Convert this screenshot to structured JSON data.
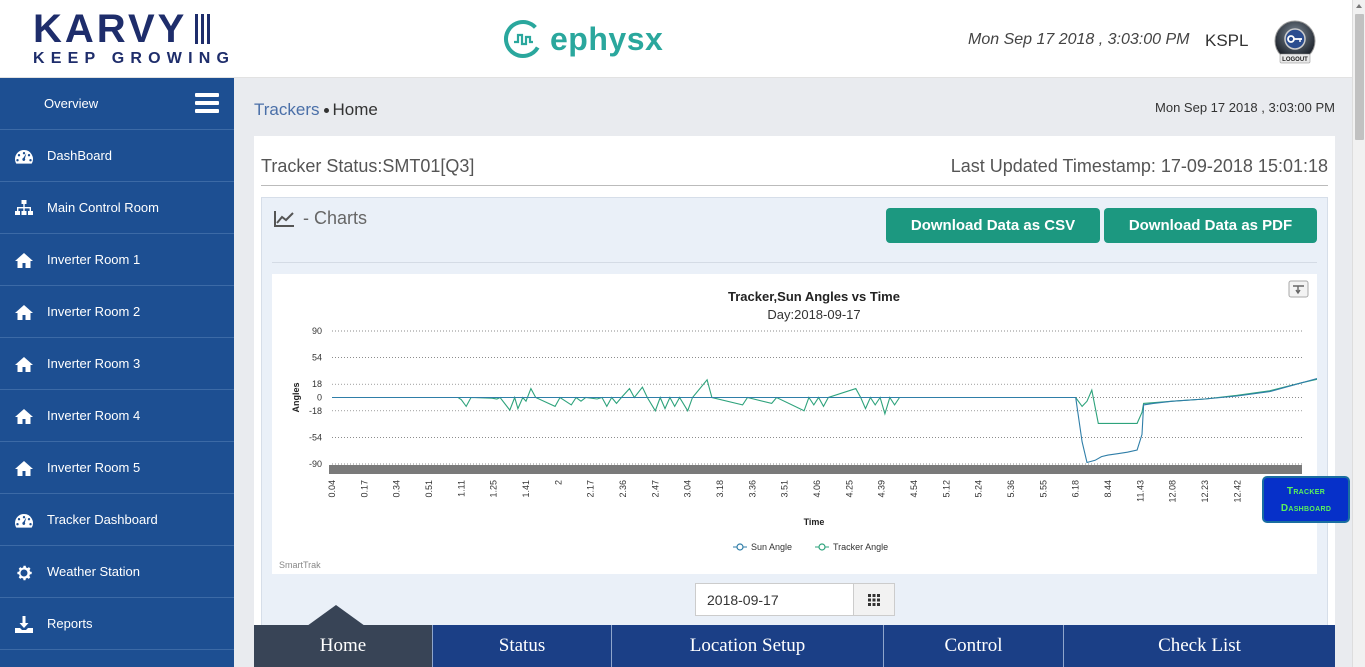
{
  "header": {
    "brand_name": "KARVY",
    "brand_tagline": "KEEP GROWING",
    "ephysx_name": "ephysx",
    "datetime": "Mon Sep 17 2018 , 3:03:00 PM",
    "user": "KSPL",
    "logout_label": "LOGOUT"
  },
  "sidebar": {
    "top_label": "Overview",
    "items": [
      {
        "label": "DashBoard",
        "icon": "dashboard-gauge-icon"
      },
      {
        "label": "Main Control Room",
        "icon": "sitemap-icon"
      },
      {
        "label": "Inverter Room 1",
        "icon": "home-icon"
      },
      {
        "label": "Inverter Room 2",
        "icon": "home-icon"
      },
      {
        "label": "Inverter Room 3",
        "icon": "home-icon"
      },
      {
        "label": "Inverter Room 4",
        "icon": "home-icon"
      },
      {
        "label": "Inverter Room 5",
        "icon": "home-icon"
      },
      {
        "label": "Tracker Dashboard",
        "icon": "dashboard-gauge-icon"
      },
      {
        "label": "Weather Station",
        "icon": "gear-icon"
      },
      {
        "label": "Reports",
        "icon": "download-icon"
      }
    ]
  },
  "breadcrumb": {
    "link": "Trackers",
    "current": "Home"
  },
  "content_time": "Mon Sep 17 2018 , 3:03:00 PM",
  "status": {
    "title": "Tracker Status:SMT01[Q3]",
    "last_updated": "Last Updated Timestamp: 17-09-2018 15:01:18"
  },
  "charts": {
    "heading": "- Charts",
    "csv_label": "Download Data as CSV",
    "pdf_label": "Download Data as PDF",
    "credit": "SmartTrak"
  },
  "chart_data": {
    "type": "line",
    "title": "Tracker,Sun Angles vs Time",
    "subtitle": "Day:2018-09-17",
    "xlabel": "Time",
    "ylabel": "Angles",
    "ylim": [
      -90,
      90
    ],
    "y_ticks": [
      90,
      54,
      18,
      0,
      -18,
      -54,
      -90
    ],
    "x_ticks": [
      "0.04",
      "0.17",
      "0.34",
      "0.51",
      "1.11",
      "1.25",
      "1.41",
      "2",
      "2.17",
      "2.36",
      "2.47",
      "3.04",
      "3.18",
      "3.36",
      "3.51",
      "4.06",
      "4.25",
      "4.39",
      "4.54",
      "5.12",
      "5.24",
      "5.36",
      "5.55",
      "6.18",
      "8.44",
      "11.43",
      "12.08",
      "12.23",
      "12.42",
      "13.14",
      "14.03"
    ],
    "legend": "bottom-center",
    "grid": true,
    "series": [
      {
        "name": "Sun Angle",
        "color": "#2f7ea8",
        "points": [
          [
            0,
            0
          ],
          [
            23,
            0
          ],
          [
            23.2,
            -60
          ],
          [
            23.35,
            -88
          ],
          [
            23.6,
            -85
          ],
          [
            23.8,
            -80
          ],
          [
            24.0,
            -78
          ],
          [
            24.3,
            -76
          ],
          [
            24.6,
            -74
          ],
          [
            24.9,
            -71
          ],
          [
            25.05,
            -50
          ],
          [
            25.1,
            -10
          ],
          [
            25.4,
            -8
          ],
          [
            26,
            -5
          ],
          [
            27,
            -2
          ],
          [
            28,
            2
          ],
          [
            29,
            8
          ],
          [
            30,
            20
          ],
          [
            31,
            32
          ],
          [
            31.4,
            40
          ],
          [
            32.0,
            45
          ]
        ]
      },
      {
        "name": "Tracker Angle",
        "color": "#2ea37c",
        "points": [
          [
            0,
            0
          ],
          [
            3.9,
            0
          ],
          [
            4.0,
            -3
          ],
          [
            4.15,
            -12
          ],
          [
            4.3,
            0
          ],
          [
            4.95,
            -1
          ],
          [
            5.1,
            -2
          ],
          [
            5.2,
            0
          ],
          [
            5.5,
            -17
          ],
          [
            5.65,
            0
          ],
          [
            5.75,
            -15
          ],
          [
            5.9,
            0
          ],
          [
            6.0,
            -5
          ],
          [
            6.15,
            12
          ],
          [
            6.3,
            0
          ],
          [
            6.9,
            -12
          ],
          [
            7.05,
            0
          ],
          [
            7.4,
            -10
          ],
          [
            7.55,
            0
          ],
          [
            7.7,
            -5
          ],
          [
            7.85,
            0
          ],
          [
            8.2,
            -2
          ],
          [
            8.35,
            0
          ],
          [
            8.5,
            -12
          ],
          [
            8.65,
            0
          ],
          [
            8.8,
            -8
          ],
          [
            8.95,
            0
          ],
          [
            9.2,
            12
          ],
          [
            9.35,
            0
          ],
          [
            9.6,
            14
          ],
          [
            9.75,
            0
          ],
          [
            10.0,
            -18
          ],
          [
            10.15,
            0
          ],
          [
            10.3,
            -15
          ],
          [
            10.45,
            0
          ],
          [
            10.6,
            -12
          ],
          [
            10.75,
            0
          ],
          [
            11.0,
            -18
          ],
          [
            11.15,
            0
          ],
          [
            11.6,
            24
          ],
          [
            11.75,
            0
          ],
          [
            12.7,
            -10
          ],
          [
            12.85,
            0
          ],
          [
            13.6,
            -8
          ],
          [
            13.75,
            0
          ],
          [
            14.6,
            -18
          ],
          [
            14.75,
            0
          ],
          [
            14.9,
            -10
          ],
          [
            15.05,
            0
          ],
          [
            15.2,
            -12
          ],
          [
            15.35,
            0
          ],
          [
            16.2,
            12
          ],
          [
            16.35,
            0
          ],
          [
            16.5,
            -15
          ],
          [
            16.65,
            0
          ],
          [
            16.8,
            -10
          ],
          [
            16.95,
            0
          ],
          [
            17.1,
            -22
          ],
          [
            17.25,
            0
          ],
          [
            17.4,
            -10
          ],
          [
            17.55,
            0
          ],
          [
            23,
            0
          ],
          [
            23.2,
            -12
          ],
          [
            23.35,
            -5
          ],
          [
            23.5,
            10
          ],
          [
            23.7,
            -35
          ],
          [
            24.9,
            -35
          ],
          [
            25.05,
            -20
          ],
          [
            25.1,
            -8
          ],
          [
            25.4,
            -7
          ],
          [
            26,
            -5
          ],
          [
            27,
            -2
          ],
          [
            28,
            3
          ],
          [
            29,
            9
          ],
          [
            30,
            20
          ],
          [
            31,
            30
          ],
          [
            31.4,
            33
          ],
          [
            32.0,
            33
          ]
        ]
      }
    ]
  },
  "date_input": {
    "value": "2018-09-17"
  },
  "tracker_dashboard": {
    "line1": "Tracker",
    "line2": "Dashboard"
  },
  "bottom_nav": [
    {
      "label": "Home",
      "active": true
    },
    {
      "label": "Status",
      "active": false
    },
    {
      "label": "Location Setup",
      "active": false
    },
    {
      "label": "Control",
      "active": false
    },
    {
      "label": "Check List",
      "active": false
    }
  ],
  "colors": {
    "sidebar": "#1d4f92",
    "accent_button": "#1c9880",
    "bottom_nav": "#1b3f86"
  }
}
